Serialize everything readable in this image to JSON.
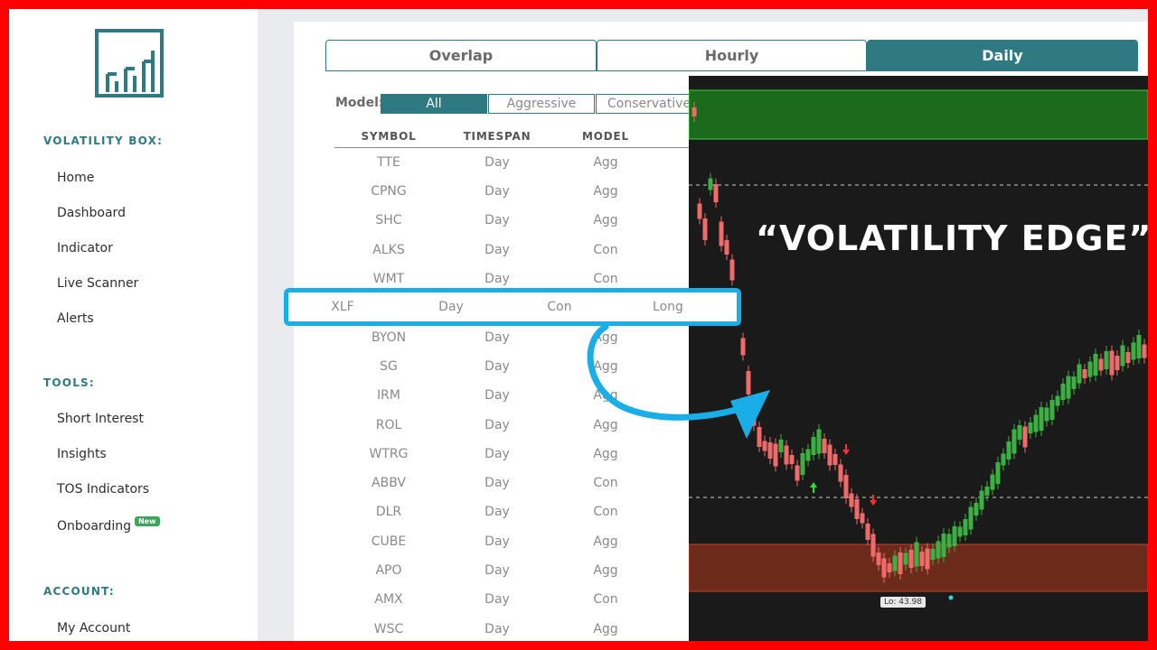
{
  "sidebar": {
    "sections": [
      {
        "title": "VOLATILITY BOX:",
        "items": [
          "Home",
          "Dashboard",
          "Indicator",
          "Live Scanner",
          "Alerts"
        ]
      },
      {
        "title": "TOOLS:",
        "items": [
          "Short Interest",
          "Insights",
          "TOS Indicators",
          "Onboarding"
        ]
      },
      {
        "title": "ACCOUNT:",
        "items": [
          "My Account"
        ]
      }
    ],
    "onboarding_badge": "New"
  },
  "tabs": [
    "Overlap",
    "Hourly",
    "Daily"
  ],
  "active_tab": "Daily",
  "model_filter": {
    "label": "Model:",
    "options": [
      "All",
      "Aggressive",
      "Conservative"
    ],
    "selected": "All"
  },
  "table": {
    "columns": [
      "SYMBOL",
      "TIMESPAN",
      "MODEL"
    ],
    "rows": [
      [
        "TTE",
        "Day",
        "Agg"
      ],
      [
        "CPNG",
        "Day",
        "Agg"
      ],
      [
        "SHC",
        "Day",
        "Agg"
      ],
      [
        "ALKS",
        "Day",
        "Con"
      ],
      [
        "WMT",
        "Day",
        "Con"
      ],
      [
        "BYON",
        "Day",
        "Agg"
      ],
      [
        "SG",
        "Day",
        "Agg"
      ],
      [
        "IRM",
        "Day",
        "Agg"
      ],
      [
        "ROL",
        "Day",
        "Agg"
      ],
      [
        "WTRG",
        "Day",
        "Agg"
      ],
      [
        "ABBV",
        "Day",
        "Con"
      ],
      [
        "DLR",
        "Day",
        "Con"
      ],
      [
        "CUBE",
        "Day",
        "Agg"
      ],
      [
        "APO",
        "Day",
        "Agg"
      ],
      [
        "AMX",
        "Day",
        "Con"
      ],
      [
        "WSC",
        "Day",
        "Agg"
      ]
    ],
    "highlighted_row": [
      "XLF",
      "Day",
      "Con",
      "Long"
    ]
  },
  "chart": {
    "headline": "“VOLATILITY EDGE”",
    "low_label": "Lo: 43.98"
  },
  "colors": {
    "accent": "#2f7a82",
    "frame": "#ff0000",
    "callout": "#1aaee8",
    "up_candle": "#3cb043",
    "down_candle": "#f06a6a",
    "upper_zone": "#1c6b1c",
    "lower_zone": "#6b2a1a"
  }
}
